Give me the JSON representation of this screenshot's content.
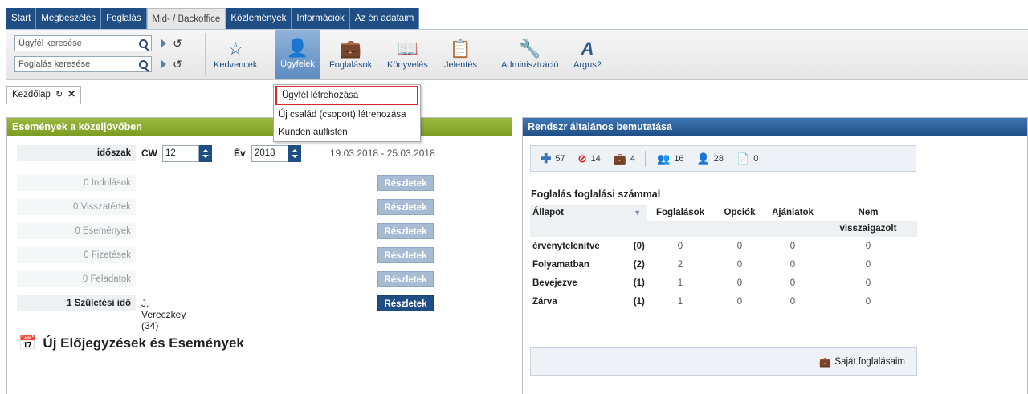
{
  "tabs": [
    {
      "label": "Start",
      "active": false
    },
    {
      "label": "Megbeszélés",
      "active": false
    },
    {
      "label": "Foglalás",
      "active": false
    },
    {
      "label": "Mid- / Backoffice",
      "active": true
    },
    {
      "label": "Közlemények",
      "active": false
    },
    {
      "label": "Információk",
      "active": false
    },
    {
      "label": "Az én adataim",
      "active": false
    }
  ],
  "search": {
    "client_placeholder": "Ügyfél keresése",
    "booking_placeholder": "Foglalás keresése"
  },
  "toolbar": {
    "items": [
      {
        "label": "Kedvencek",
        "icon": "star-icon"
      },
      {
        "label": "Ügyfelek",
        "icon": "customer-icon",
        "active": true
      },
      {
        "label": "Foglalások",
        "icon": "suitcase-icon"
      },
      {
        "label": "Könyvelés",
        "icon": "book-icon"
      },
      {
        "label": "Jelentés",
        "icon": "report-icon"
      },
      {
        "label": "Adminisztráció",
        "icon": "tools-icon"
      },
      {
        "label": "Argus2",
        "icon": "argus-icon"
      }
    ]
  },
  "dropdown": {
    "items": [
      "Ügyfél létrehozása",
      "Új család (csoport) létrehozása",
      "Kunden auflisten"
    ],
    "highlighted_index": 0
  },
  "page_tab": {
    "label": "Kezdőlap"
  },
  "left": {
    "title": "Események a közeljövőben",
    "period_label": "időszak",
    "cw_label": "CW",
    "cw_value": "12",
    "year_label": "Év",
    "year_value": "2018",
    "date_range": "19.03.2018 - 25.03.2018",
    "rows": [
      {
        "label": "0 Indulások",
        "detail": "",
        "button": "Részletek",
        "active": false
      },
      {
        "label": "0 Visszatértek",
        "detail": "",
        "button": "Részletek",
        "active": false
      },
      {
        "label": "0 Események",
        "detail": "",
        "button": "Részletek",
        "active": false
      },
      {
        "label": "0 Fizetések",
        "detail": "",
        "button": "Részletek",
        "active": false
      },
      {
        "label": "0 Feladatok",
        "detail": "",
        "button": "Részletek",
        "active": false
      },
      {
        "label": "1 Születési idő",
        "detail": "J. Vereczkey (34)",
        "button": "Részletek",
        "active": true
      }
    ],
    "new_events_title": "Új Előjegyzések és Események"
  },
  "right": {
    "title": "Rendszr általános bemutatása",
    "stats": [
      {
        "icon": "plus-icon",
        "value": "57",
        "color": "#3b73b9"
      },
      {
        "icon": "blocked-icon",
        "value": "14",
        "color": "#d62020"
      },
      {
        "icon": "suitcase-icon",
        "value": "4",
        "color": "#5b7da3"
      },
      {
        "icon": "users-icon",
        "value": "16",
        "color": "#3b73b9"
      },
      {
        "icon": "user-icon",
        "value": "28",
        "color": "#3b73b9"
      },
      {
        "icon": "document-icon",
        "value": "0",
        "color": "#5b7da3"
      }
    ],
    "section_title": "Foglalás foglalási számmal",
    "table": {
      "headers": [
        "Állapot",
        "Foglalások",
        "Opciók",
        "Ajánlatok",
        "Nem visszaigazolt"
      ],
      "header_line1": "Nem",
      "header_line2": "visszaigazolt",
      "rows": [
        {
          "state": "érvénytelenítve",
          "count": "(0)",
          "bookings": "0",
          "options": "0",
          "offers": "0",
          "unconfirmed": "0"
        },
        {
          "state": "Folyamatban",
          "count": "(2)",
          "bookings": "2",
          "options": "0",
          "offers": "0",
          "unconfirmed": "0"
        },
        {
          "state": "Bevejezve",
          "count": "(1)",
          "bookings": "1",
          "options": "0",
          "offers": "0",
          "unconfirmed": "0"
        },
        {
          "state": "Zárva",
          "count": "(1)",
          "bookings": "1",
          "options": "0",
          "offers": "0",
          "unconfirmed": "0"
        }
      ]
    },
    "my_bookings": "Saját foglalásaim"
  }
}
